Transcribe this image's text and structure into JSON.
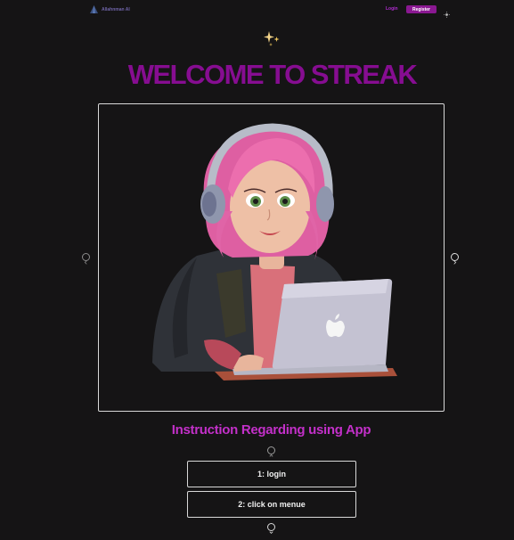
{
  "header": {
    "logo_text": "Allahnman AI",
    "login_label": "Login",
    "register_label": "Register",
    "logo_icon": "pyramid-logo-icon",
    "theme_icon": "sun-icon"
  },
  "hero": {
    "sparkle_icon": "sparkle-icon",
    "title": "WELCOME TO STREAK"
  },
  "carousel": {
    "image": "girl-with-headphones-using-laptop",
    "prev_icon": "chevron-left-icon",
    "next_icon": "chevron-right-icon"
  },
  "instructions": {
    "title": "Instruction Regarding using App",
    "up_icon": "chevron-up-icon",
    "down_icon": "chevron-down-icon",
    "steps": [
      {
        "label": "1: login"
      },
      {
        "label": "2: click on menue"
      }
    ]
  },
  "colors": {
    "background": "#151415",
    "title": "#860d91",
    "subtitle": "#c330c9",
    "register": "#8a1891",
    "login": "#b02bd0"
  }
}
